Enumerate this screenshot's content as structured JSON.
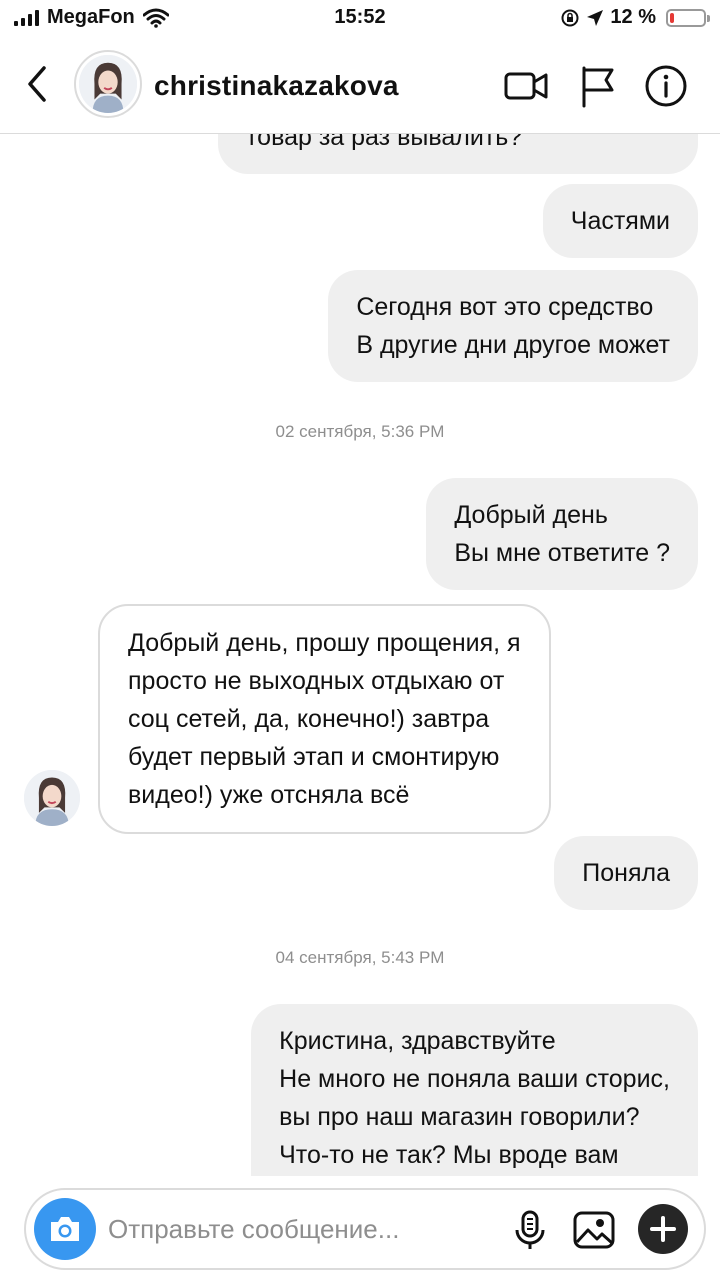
{
  "status_bar": {
    "carrier": "MegaFon",
    "time": "15:52",
    "battery": "12 %",
    "battery_level": 0.12
  },
  "header": {
    "username": "christinakazakova"
  },
  "messages": [
    {
      "direction": "out",
      "text": "товар за раз вывалить?"
    },
    {
      "direction": "out",
      "text": "Частями"
    },
    {
      "direction": "out",
      "text": "Сегодня вот это средство\nВ другие дни другое может"
    },
    {
      "timestamp": "02 сентября, 5:36 PM"
    },
    {
      "direction": "out",
      "text": "Добрый день\nВы мне ответите ?"
    },
    {
      "direction": "in",
      "text": "Добрый день, прошу прощения, я\nпросто не выходных отдыхаю от\nсоц сетей, да, конечно!) завтра\nбудет первый этап и смонтирую\nвидео!) уже отсняла всё"
    },
    {
      "direction": "out",
      "text": "Поняла"
    },
    {
      "timestamp": "04 сентября, 5:43 PM"
    },
    {
      "direction": "out",
      "text": "Кристина, здравствуйте\nНе много не поняла ваши сторис,\nвы про наш магазин говорили?\nЧто-то не так? Мы вроде вам"
    }
  ],
  "composer": {
    "placeholder": "Отправьте сообщение..."
  },
  "icons": {
    "back": "chevron-left-icon",
    "video": "video-camera-icon",
    "flag": "flag-icon",
    "info": "info-icon",
    "camera": "camera-icon",
    "mic": "microphone-icon",
    "gallery": "image-icon",
    "plus": "plus-icon",
    "wifi": "wifi-icon",
    "location": "location-arrow-icon",
    "lock": "orientation-lock-icon"
  },
  "colors": {
    "accent": "#3897f0",
    "bubble_out": "#efefef",
    "border": "#dbdbdb",
    "battery_low": "#e53935"
  }
}
